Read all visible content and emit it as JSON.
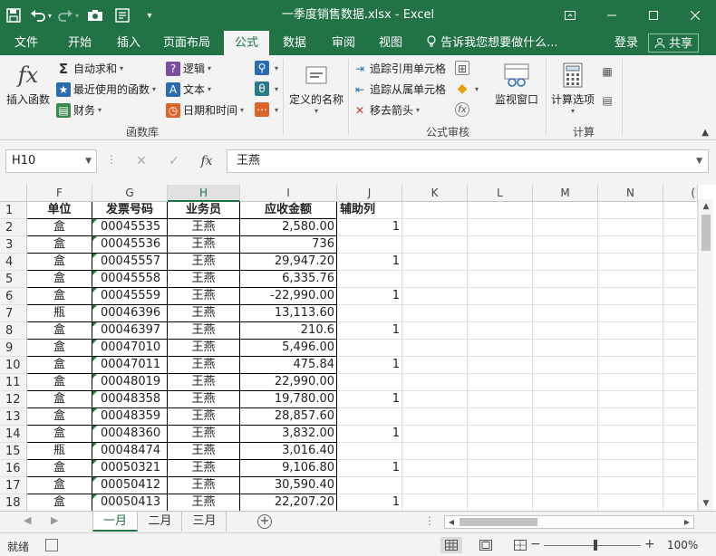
{
  "window": {
    "title": "一季度销售数据.xlsx - Excel"
  },
  "qat": {
    "save_icon": "save-icon",
    "undo_icon": "undo-icon",
    "redo_icon": "redo-icon",
    "camera_icon": "camera-icon",
    "form_icon": "form-icon",
    "customize_icon": "customize-icon"
  },
  "tabs": [
    {
      "label": "文件"
    },
    {
      "label": "开始"
    },
    {
      "label": "插入"
    },
    {
      "label": "页面布局"
    },
    {
      "label": "公式"
    },
    {
      "label": "数据"
    },
    {
      "label": "审阅"
    },
    {
      "label": "视图"
    }
  ],
  "tell_me": "告诉我您想要做什么...",
  "login": "登录",
  "share": "共享",
  "ribbon": {
    "insert_function": "插入函数",
    "autosum": "自动求和",
    "recently_used": "最近使用的函数",
    "financial": "财务",
    "logical": "逻辑",
    "text": "文本",
    "date_time": "日期和时间",
    "defined_names": "定义的名称",
    "trace_precedents": "追踪引用单元格",
    "trace_dependents": "追踪从属单元格",
    "remove_arrows": "移去箭头",
    "watch_window": "监视窗口",
    "calc_options": "计算选项",
    "group_library": "函数库",
    "group_audit": "公式审核",
    "group_calc": "计算"
  },
  "formula_bar": {
    "name_box": "H10",
    "fx": "fx",
    "value": "王燕"
  },
  "columns": [
    "F",
    "G",
    "H",
    "I",
    "J",
    "K",
    "L",
    "M",
    "N",
    "("
  ],
  "rows": [
    {
      "n": "1",
      "F": "单位",
      "G": "发票号码",
      "H": "业务员",
      "I": "应收金额",
      "J": "辅助列"
    },
    {
      "n": "2",
      "F": "盒",
      "G": "00045535",
      "H": "王燕",
      "I": "2,580.00",
      "J": "1"
    },
    {
      "n": "3",
      "F": "盒",
      "G": "00045536",
      "H": "王燕",
      "I": "736",
      "J": ""
    },
    {
      "n": "4",
      "F": "盒",
      "G": "00045557",
      "H": "王燕",
      "I": "29,947.20",
      "J": "1"
    },
    {
      "n": "5",
      "F": "盒",
      "G": "00045558",
      "H": "王燕",
      "I": "6,335.76",
      "J": ""
    },
    {
      "n": "6",
      "F": "盒",
      "G": "00045559",
      "H": "王燕",
      "I": "-22,990.00",
      "J": "1"
    },
    {
      "n": "7",
      "F": "瓶",
      "G": "00046396",
      "H": "王燕",
      "I": "13,113.60",
      "J": ""
    },
    {
      "n": "8",
      "F": "盒",
      "G": "00046397",
      "H": "王燕",
      "I": "210.6",
      "J": "1"
    },
    {
      "n": "9",
      "F": "盒",
      "G": "00047010",
      "H": "王燕",
      "I": "5,496.00",
      "J": ""
    },
    {
      "n": "10",
      "F": "盒",
      "G": "00047011",
      "H": "王燕",
      "I": "475.84",
      "J": "1"
    },
    {
      "n": "11",
      "F": "盒",
      "G": "00048019",
      "H": "王燕",
      "I": "22,990.00",
      "J": ""
    },
    {
      "n": "12",
      "F": "盒",
      "G": "00048358",
      "H": "王燕",
      "I": "19,780.00",
      "J": "1"
    },
    {
      "n": "13",
      "F": "盒",
      "G": "00048359",
      "H": "王燕",
      "I": "28,857.60",
      "J": ""
    },
    {
      "n": "14",
      "F": "盒",
      "G": "00048360",
      "H": "王燕",
      "I": "3,832.00",
      "J": "1"
    },
    {
      "n": "15",
      "F": "瓶",
      "G": "00048474",
      "H": "王燕",
      "I": "3,016.40",
      "J": ""
    },
    {
      "n": "16",
      "F": "盒",
      "G": "00050321",
      "H": "王燕",
      "I": "9,106.80",
      "J": "1"
    },
    {
      "n": "17",
      "F": "盒",
      "G": "00050412",
      "H": "王燕",
      "I": "30,590.40",
      "J": ""
    },
    {
      "n": "18",
      "F": "盒",
      "G": "00050413",
      "H": "王燕",
      "I": "22,207.20",
      "J": "1"
    }
  ],
  "sheets": [
    {
      "label": "一月"
    },
    {
      "label": "二月"
    },
    {
      "label": "三月"
    }
  ],
  "status": {
    "ready": "就绪",
    "zoom": "100%"
  },
  "colors": {
    "brand": "#217346",
    "text_mark": "#1e7c3e"
  }
}
